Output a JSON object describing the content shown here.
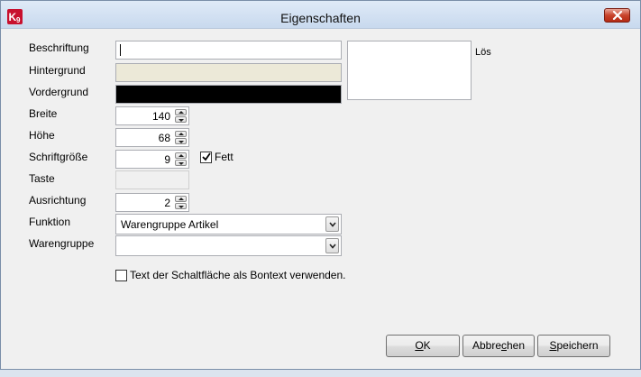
{
  "window": {
    "title": "Eigenschaften",
    "app_icon_letter": "K",
    "app_icon_digit": "9",
    "colors": {
      "app_icon": "#c8102e",
      "close": "#c8432b"
    }
  },
  "form": {
    "beschriftung": {
      "label": "Beschriftung",
      "value": ""
    },
    "hintergrund": {
      "label": "Hintergrund",
      "color": "#ece9d8"
    },
    "vordergrund": {
      "label": "Vordergrund",
      "color": "#000000"
    },
    "breite": {
      "label": "Breite",
      "value": "140"
    },
    "hoehe": {
      "label": "Höhe",
      "value": "68"
    },
    "schriftgroesse": {
      "label": "Schriftgröße",
      "value": "9"
    },
    "fett": {
      "label": "Fett",
      "checked": true
    },
    "taste": {
      "label": "Taste"
    },
    "ausrichtung": {
      "label": "Ausrichtung",
      "value": "2"
    },
    "funktion": {
      "label": "Funktion",
      "value": "Warengruppe Artikel"
    },
    "warengruppe": {
      "label": "Warengruppe",
      "value": ""
    },
    "bontext": {
      "label": "Text der Schaltfläche als Bontext verwenden.",
      "checked": false
    }
  },
  "preview": {
    "label": "Lös"
  },
  "buttons": {
    "ok": {
      "acc": "O",
      "rest": "K"
    },
    "abbrechen": {
      "pre": "Abbre",
      "acc": "c",
      "rest": "hen"
    },
    "speichern": {
      "acc": "S",
      "rest": "peichern"
    }
  }
}
